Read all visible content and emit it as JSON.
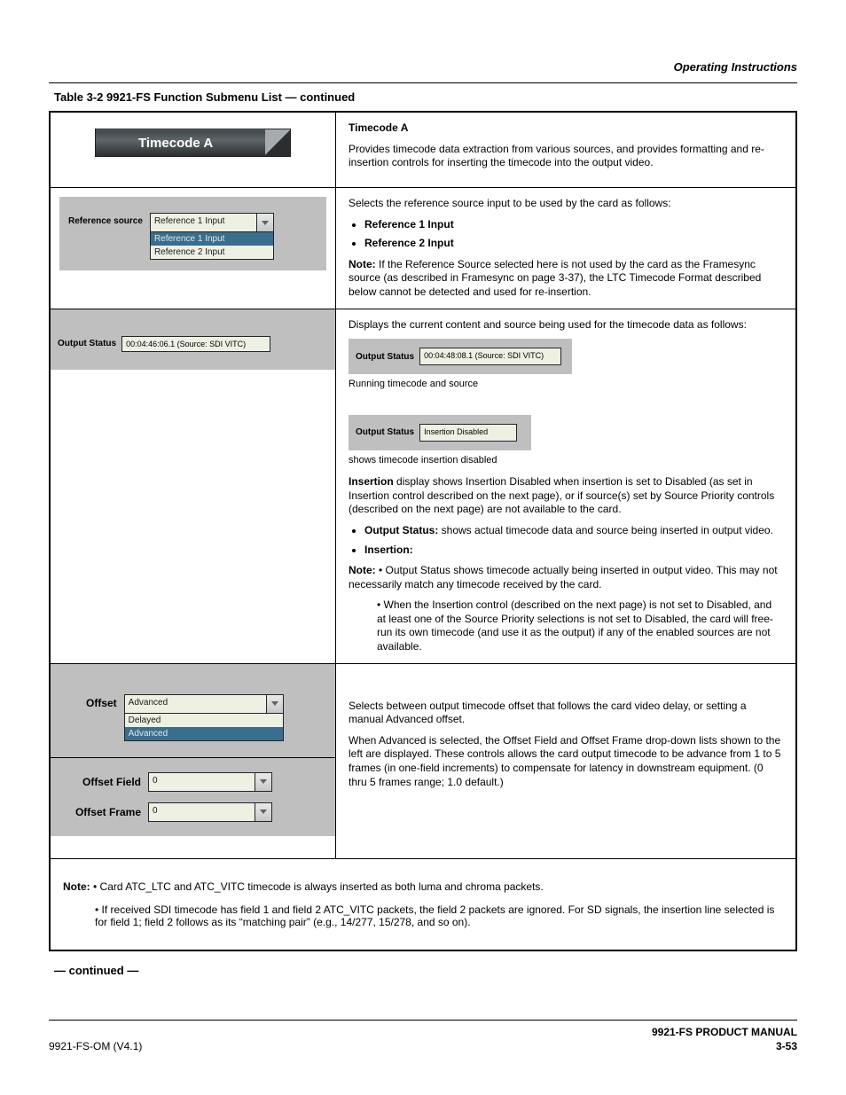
{
  "running_head": "Operating Instructions",
  "table_caption": "Table 3-2   9921-FS Function Submenu List — continued",
  "banner": {
    "title": "Timecode A"
  },
  "row1_right": {
    "heading": "Timecode A",
    "body": "Provides timecode data extraction from various sources, and provides formatting and re-insertion controls for inserting the timecode into the output video."
  },
  "row2_left": {
    "label": "Reference source",
    "selected": "Reference 1 Input",
    "options": [
      "Reference 1 Input",
      "Reference 2 Input"
    ]
  },
  "row2_right": {
    "p1": "Selects the reference source input to be used by the card as follows:",
    "li1": "Reference 1 Input",
    "li2": "Reference 2 Input",
    "note_label": "Note:",
    "note_body": "If the Reference Source selected here is not used by the card as the Framesync source (as described in Framesync on page 3-37), the LTC Timecode Format described below cannot be detected and used for re-insertion."
  },
  "row3_left": {
    "label": "Output Status",
    "value": "00:04:46:06.1 (Source: SDI VITC)"
  },
  "row3_right": {
    "p_intro": "Displays the current content and source being used for the timecode data as follows:",
    "status1_label": "Output Status",
    "status1_value": "00:04:48:08.1 (Source: SDI VITC)",
    "caption1_a": "Running timecode",
    "caption1_b": "and source",
    "status2_label": "Output Status",
    "status2_value": "Insertion Disabled",
    "caption2": "shows timecode insertion disabled",
    "insertion_heading_label": "Insertion",
    "insertion_heading_body": "display shows Insertion Disabled when insertion is set to Disabled (as set in Insertion control described on the next page), or if source(s) set by Source Priority controls (described on the next page) are not available to the card.",
    "bul_a_label": "Output Status: ",
    "bul_a_body": "shows actual timecode data and source being inserted in output video.",
    "bul_b_label": "Insertion:",
    "note_label": "Note:",
    "note_body_a": "Output Status shows timecode actually being inserted in output video. This may not necessarily match any timecode received by the card.",
    "note_body_b": "When the Insertion control (described on the next page) is not set to Disabled, and at least one of the Source Priority selections is not set to Disabled, the card will free-run its own timecode (and use it as the output) if any of the enabled sources are not available."
  },
  "row4_left": {
    "offset_label": "Offset",
    "offset_selected": "Advanced",
    "offset_options": [
      "Delayed",
      "Advanced"
    ],
    "offset_field_label": "Offset Field",
    "offset_field_value": "0",
    "offset_frame_label": "Offset Frame",
    "offset_frame_value": "0"
  },
  "row4_right": {
    "p1": "Selects between output timecode offset that follows the card video delay, or setting a manual Advanced offset.",
    "p2": "When Advanced is selected, the Offset Field and Offset Frame drop-down lists shown to the left are displayed. These controls allows the card output timecode to be advance from 1 to 5 frames (in one-field increments) to compensate for latency in downstream equipment. (0 thru 5 frames range; 1.0 default.)"
  },
  "row5": {
    "note_label": "Note:",
    "note1": "Card ATC_LTC and ATC_VITC timecode is always inserted as both luma and chroma packets.",
    "note2": "If received SDI timecode has field 1 and field 2 ATC_VITC packets, the field 2 packets are ignored. For SD signals, the insertion line selected is for field 1; field 2 follows as its “matching pair” (e.g., 14/277, 15/278, and so on)."
  },
  "continued": "— continued —",
  "footer": {
    "doc": "9921-FS PRODUCT MANUAL",
    "left": "9921-FS-OM (V4.1)",
    "right": "3-53"
  }
}
